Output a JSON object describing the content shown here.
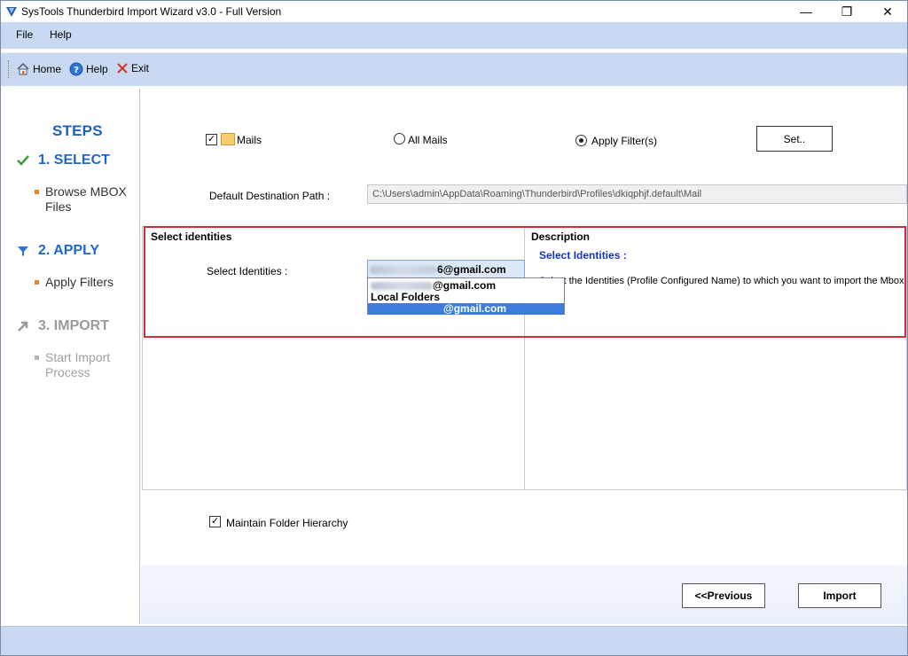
{
  "window": {
    "title": "SysTools Thunderbird Import Wizard v3.0 - Full Version",
    "min_glyph": "—",
    "max_glyph": "❐",
    "close_glyph": "✕"
  },
  "menu": {
    "file": "File",
    "help": "Help"
  },
  "toolbar": {
    "home": "Home",
    "help": "Help",
    "exit": "Exit"
  },
  "steps": {
    "title": "STEPS",
    "items": [
      {
        "label": "1. SELECT",
        "icon": "checkmark-icon",
        "sub": "Browse MBOX Files"
      },
      {
        "label": "2. APPLY",
        "icon": "filter-icon",
        "sub": "Apply Filters"
      },
      {
        "label": "3. IMPORT",
        "icon": "arrow-icon",
        "sub": "Start Import Process"
      }
    ]
  },
  "filters": {
    "mails_label": "Mails",
    "mails_checked": true,
    "all_mails_label": "All Mails",
    "apply_filters_label": "Apply Filter(s)",
    "selected_option": "Apply Filter(s)",
    "set_button": "Set.."
  },
  "destination": {
    "label": "Default Destination Path :",
    "value": "C:\\Users\\admin\\AppData\\Roaming\\Thunderbird\\Profiles\\dkiqphjf.default\\Mail"
  },
  "identities": {
    "group_title": "Select identities",
    "label": "Select Identities :",
    "selected_suffix": "6@gmail.com",
    "options": [
      "@gmail.com",
      "Local Folders",
      "@gmail.com"
    ],
    "highlighted_index": 2
  },
  "description": {
    "group_title": "Description",
    "heading": "Select Identities :",
    "text": "Select the Identities (Profile Configured Name) to  which  you want to import the Mbox"
  },
  "options": {
    "hierarchy_label": "Maintain Folder Hierarchy",
    "hierarchy_checked": true
  },
  "nav": {
    "previous": "<<Previous",
    "import": "Import"
  },
  "colors": {
    "chrome": "#c9d9f1",
    "accent_blue": "#1f68c9",
    "highlight_frame": "#cf2f3b",
    "selection": "#3f7ddc",
    "check_green": "#3aa23a",
    "bullet_orange": "#e8852b"
  }
}
